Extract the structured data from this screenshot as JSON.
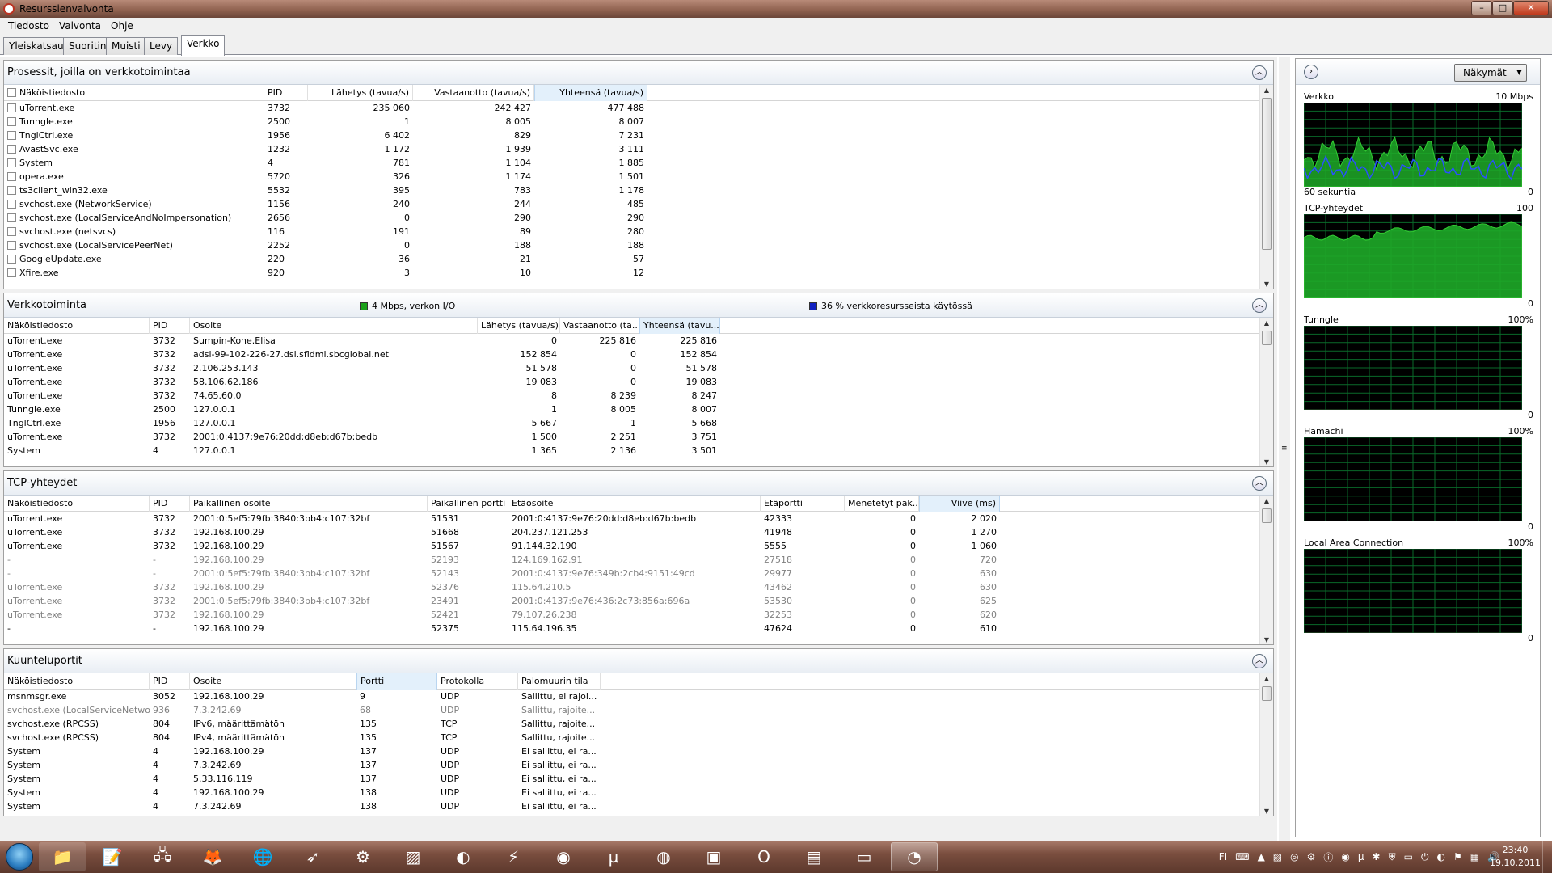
{
  "window": {
    "title": "Resurssienvalvonta"
  },
  "menu": [
    "Tiedosto",
    "Valvonta",
    "Ohje"
  ],
  "tabs": [
    "Yleiskatsaus",
    "Suoritin",
    "Muisti",
    "Levy",
    "Verkko"
  ],
  "active_tab": "Verkko",
  "processes": {
    "title": "Prosessit, joilla on verkkotoimintaa",
    "headers": [
      "Näköistiedosto",
      "PID",
      "Lähetys (tavua/s)",
      "Vastaanotto (tavua/s)",
      "Yhteensä (tavua/s)"
    ],
    "rows": [
      [
        "uTorrent.exe",
        "3732",
        "235 060",
        "242 427",
        "477 488"
      ],
      [
        "Tunngle.exe",
        "2500",
        "1",
        "8 005",
        "8 007"
      ],
      [
        "TnglCtrl.exe",
        "1956",
        "6 402",
        "829",
        "7 231"
      ],
      [
        "AvastSvc.exe",
        "1232",
        "1 172",
        "1 939",
        "3 111"
      ],
      [
        "System",
        "4",
        "781",
        "1 104",
        "1 885"
      ],
      [
        "opera.exe",
        "5720",
        "326",
        "1 174",
        "1 501"
      ],
      [
        "ts3client_win32.exe",
        "5532",
        "395",
        "783",
        "1 178"
      ],
      [
        "svchost.exe (NetworkService)",
        "1156",
        "240",
        "244",
        "485"
      ],
      [
        "svchost.exe (LocalServiceAndNoImpersonation)",
        "2656",
        "0",
        "290",
        "290"
      ],
      [
        "svchost.exe (netsvcs)",
        "116",
        "191",
        "89",
        "280"
      ],
      [
        "svchost.exe (LocalServicePeerNet)",
        "2252",
        "0",
        "188",
        "188"
      ],
      [
        "GoogleUpdate.exe",
        "220",
        "36",
        "21",
        "57"
      ],
      [
        "Xfire.exe",
        "920",
        "3",
        "10",
        "12"
      ]
    ]
  },
  "network": {
    "title": "Verkkotoiminta",
    "legend1": "4 Mbps, verkon I/O",
    "legend2": "36 % verkkoresursseista käytössä",
    "legend1_color": "#1aa01a",
    "legend2_color": "#1020c0",
    "headers": [
      "Näköistiedosto",
      "PID",
      "Osoite",
      "Lähetys (tavua/s)",
      "Vastaanotto (ta...",
      "Yhteensä (tavu..."
    ],
    "rows": [
      [
        "uTorrent.exe",
        "3732",
        "Sumpin-Kone.Elisa",
        "0",
        "225 816",
        "225 816"
      ],
      [
        "uTorrent.exe",
        "3732",
        "adsl-99-102-226-27.dsl.sfldmi.sbcglobal.net",
        "152 854",
        "0",
        "152 854"
      ],
      [
        "uTorrent.exe",
        "3732",
        "2.106.253.143",
        "51 578",
        "0",
        "51 578"
      ],
      [
        "uTorrent.exe",
        "3732",
        "58.106.62.186",
        "19 083",
        "0",
        "19 083"
      ],
      [
        "uTorrent.exe",
        "3732",
        "74.65.60.0",
        "8",
        "8 239",
        "8 247"
      ],
      [
        "Tunngle.exe",
        "2500",
        "127.0.0.1",
        "1",
        "8 005",
        "8 007"
      ],
      [
        "TnglCtrl.exe",
        "1956",
        "127.0.0.1",
        "5 667",
        "1",
        "5 668"
      ],
      [
        "uTorrent.exe",
        "3732",
        "2001:0:4137:9e76:20dd:d8eb:d67b:bedb",
        "1 500",
        "2 251",
        "3 751"
      ],
      [
        "System",
        "4",
        "127.0.0.1",
        "1 365",
        "2 136",
        "3 501"
      ]
    ]
  },
  "tcp": {
    "title": "TCP-yhteydet",
    "headers": [
      "Näköistiedosto",
      "PID",
      "Paikallinen osoite",
      "Paikallinen portti",
      "Etäosoite",
      "Etäportti",
      "Menetetyt pak...",
      "Viive (ms)"
    ],
    "rows": [
      {
        "v": [
          "uTorrent.exe",
          "3732",
          "2001:0:5ef5:79fb:3840:3bb4:c107:32bf",
          "51531",
          "2001:0:4137:9e76:20dd:d8eb:d67b:bedb",
          "42333",
          "0",
          "2 020"
        ],
        "gray": false
      },
      {
        "v": [
          "uTorrent.exe",
          "3732",
          "192.168.100.29",
          "51668",
          "204.237.121.253",
          "41948",
          "0",
          "1 270"
        ],
        "gray": false
      },
      {
        "v": [
          "uTorrent.exe",
          "3732",
          "192.168.100.29",
          "51567",
          "91.144.32.190",
          "5555",
          "0",
          "1 060"
        ],
        "gray": false
      },
      {
        "v": [
          "-",
          "-",
          "192.168.100.29",
          "52193",
          "124.169.162.91",
          "27518",
          "0",
          "720"
        ],
        "gray": true
      },
      {
        "v": [
          "-",
          "-",
          "2001:0:5ef5:79fb:3840:3bb4:c107:32bf",
          "52143",
          "2001:0:4137:9e76:349b:2cb4:9151:49cd",
          "29977",
          "0",
          "630"
        ],
        "gray": true
      },
      {
        "v": [
          "uTorrent.exe",
          "3732",
          "192.168.100.29",
          "52376",
          "115.64.210.5",
          "43462",
          "0",
          "630"
        ],
        "gray": true
      },
      {
        "v": [
          "uTorrent.exe",
          "3732",
          "2001:0:5ef5:79fb:3840:3bb4:c107:32bf",
          "23491",
          "2001:0:4137:9e76:436:2c73:856a:696a",
          "53530",
          "0",
          "625"
        ],
        "gray": true
      },
      {
        "v": [
          "uTorrent.exe",
          "3732",
          "192.168.100.29",
          "52421",
          "79.107.26.238",
          "32253",
          "0",
          "620"
        ],
        "gray": true
      },
      {
        "v": [
          "-",
          "-",
          "192.168.100.29",
          "52375",
          "115.64.196.35",
          "47624",
          "0",
          "610"
        ],
        "gray": false
      }
    ]
  },
  "listen": {
    "title": "Kuunteluportit",
    "headers": [
      "Näköistiedosto",
      "PID",
      "Osoite",
      "Portti",
      "Protokolla",
      "Palomuurin tila"
    ],
    "rows": [
      {
        "v": [
          "msnmsgr.exe",
          "3052",
          "192.168.100.29",
          "9",
          "UDP",
          "Sallittu, ei rajoi..."
        ],
        "gray": false
      },
      {
        "v": [
          "svchost.exe (LocalServiceNetwo...",
          "936",
          "7.3.242.69",
          "68",
          "UDP",
          "Sallittu, rajoite..."
        ],
        "gray": true
      },
      {
        "v": [
          "svchost.exe (RPCSS)",
          "804",
          "IPv6, määrittämätön",
          "135",
          "TCP",
          "Sallittu, rajoite..."
        ],
        "gray": false
      },
      {
        "v": [
          "svchost.exe (RPCSS)",
          "804",
          "IPv4, määrittämätön",
          "135",
          "TCP",
          "Sallittu, rajoite..."
        ],
        "gray": false
      },
      {
        "v": [
          "System",
          "4",
          "192.168.100.29",
          "137",
          "UDP",
          "Ei sallittu, ei ra..."
        ],
        "gray": false
      },
      {
        "v": [
          "System",
          "4",
          "7.3.242.69",
          "137",
          "UDP",
          "Ei sallittu, ei ra..."
        ],
        "gray": false
      },
      {
        "v": [
          "System",
          "4",
          "5.33.116.119",
          "137",
          "UDP",
          "Ei sallittu, ei ra..."
        ],
        "gray": false
      },
      {
        "v": [
          "System",
          "4",
          "192.168.100.29",
          "138",
          "UDP",
          "Ei sallittu, ei ra..."
        ],
        "gray": false
      },
      {
        "v": [
          "System",
          "4",
          "7.3.242.69",
          "138",
          "UDP",
          "Ei sallittu, ei ra..."
        ],
        "gray": false
      }
    ]
  },
  "right_pane": {
    "views_button": "Näkymät",
    "graphs": [
      {
        "name": "Verkko",
        "max": "10 Mbps",
        "bottom_left": "60 sekuntia",
        "bottom_right": "0"
      },
      {
        "name": "TCP-yhteydet",
        "max": "100",
        "bottom_left": "",
        "bottom_right": "0"
      },
      {
        "name": "Tunngle",
        "max": "100%",
        "bottom_left": "",
        "bottom_right": "0"
      },
      {
        "name": "Hamachi",
        "max": "100%",
        "bottom_left": "",
        "bottom_right": "0"
      },
      {
        "name": "Local Area Connection",
        "max": "100%",
        "bottom_left": "",
        "bottom_right": "0"
      }
    ]
  },
  "taskbar": {
    "icons": [
      "start-orb",
      "explorer",
      "notepad",
      "network",
      "fox",
      "globe",
      "arrow",
      "steam",
      "stripes",
      "media",
      "lightning",
      "lastfm",
      "utorrent",
      "firefox",
      "camera",
      "opera",
      "winrar",
      "display",
      "resource-monitor"
    ],
    "tray_lang": "FI",
    "time": "23:40",
    "date": "19.10.2011"
  }
}
